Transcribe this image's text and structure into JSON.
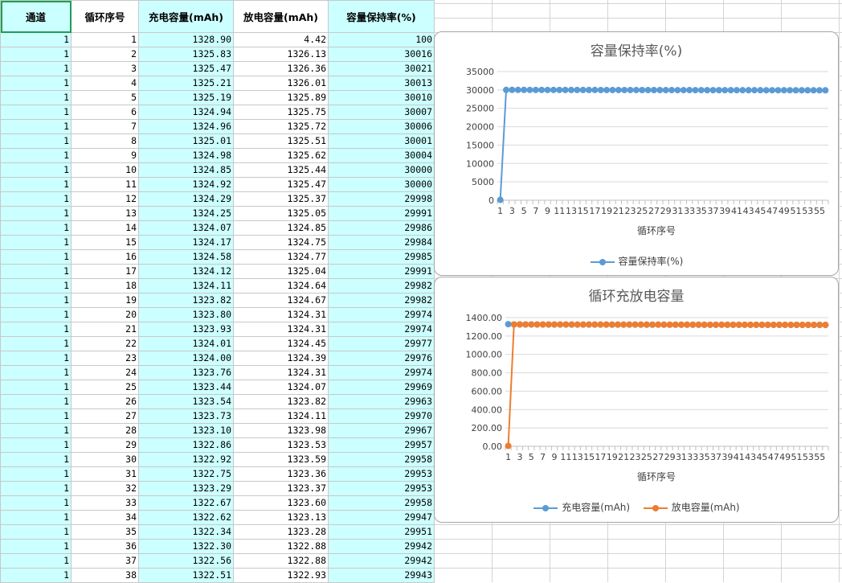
{
  "table": {
    "headers": [
      "通道",
      "循环序号",
      "充电容量(mAh)",
      "放电容量(mAh)",
      "容量保持率(%)"
    ],
    "rows": [
      [
        "1",
        "1",
        "1328.90",
        "4.42",
        "100"
      ],
      [
        "1",
        "2",
        "1325.83",
        "1326.13",
        "30016"
      ],
      [
        "1",
        "3",
        "1325.47",
        "1326.36",
        "30021"
      ],
      [
        "1",
        "4",
        "1325.21",
        "1326.01",
        "30013"
      ],
      [
        "1",
        "5",
        "1325.19",
        "1325.89",
        "30010"
      ],
      [
        "1",
        "6",
        "1324.94",
        "1325.75",
        "30007"
      ],
      [
        "1",
        "7",
        "1324.96",
        "1325.72",
        "30006"
      ],
      [
        "1",
        "8",
        "1325.01",
        "1325.51",
        "30001"
      ],
      [
        "1",
        "9",
        "1324.98",
        "1325.62",
        "30004"
      ],
      [
        "1",
        "10",
        "1324.85",
        "1325.44",
        "30000"
      ],
      [
        "1",
        "11",
        "1324.92",
        "1325.47",
        "30000"
      ],
      [
        "1",
        "12",
        "1324.29",
        "1325.37",
        "29998"
      ],
      [
        "1",
        "13",
        "1324.25",
        "1325.05",
        "29991"
      ],
      [
        "1",
        "14",
        "1324.07",
        "1324.85",
        "29986"
      ],
      [
        "1",
        "15",
        "1324.17",
        "1324.75",
        "29984"
      ],
      [
        "1",
        "16",
        "1324.58",
        "1324.77",
        "29985"
      ],
      [
        "1",
        "17",
        "1324.12",
        "1325.04",
        "29991"
      ],
      [
        "1",
        "18",
        "1324.11",
        "1324.64",
        "29982"
      ],
      [
        "1",
        "19",
        "1323.82",
        "1324.67",
        "29982"
      ],
      [
        "1",
        "20",
        "1323.80",
        "1324.31",
        "29974"
      ],
      [
        "1",
        "21",
        "1323.93",
        "1324.31",
        "29974"
      ],
      [
        "1",
        "22",
        "1324.01",
        "1324.45",
        "29977"
      ],
      [
        "1",
        "23",
        "1324.00",
        "1324.39",
        "29976"
      ],
      [
        "1",
        "24",
        "1323.76",
        "1324.31",
        "29974"
      ],
      [
        "1",
        "25",
        "1323.44",
        "1324.07",
        "29969"
      ],
      [
        "1",
        "26",
        "1323.54",
        "1323.82",
        "29963"
      ],
      [
        "1",
        "27",
        "1323.73",
        "1324.11",
        "29970"
      ],
      [
        "1",
        "28",
        "1323.10",
        "1323.98",
        "29967"
      ],
      [
        "1",
        "29",
        "1322.86",
        "1323.53",
        "29957"
      ],
      [
        "1",
        "30",
        "1322.92",
        "1323.59",
        "29958"
      ],
      [
        "1",
        "31",
        "1322.75",
        "1323.36",
        "29953"
      ],
      [
        "1",
        "32",
        "1323.29",
        "1323.37",
        "29953"
      ],
      [
        "1",
        "33",
        "1322.67",
        "1323.60",
        "29958"
      ],
      [
        "1",
        "34",
        "1322.62",
        "1323.13",
        "29947"
      ],
      [
        "1",
        "35",
        "1322.34",
        "1323.28",
        "29951"
      ],
      [
        "1",
        "36",
        "1322.30",
        "1322.88",
        "29942"
      ],
      [
        "1",
        "37",
        "1322.56",
        "1322.88",
        "29942"
      ],
      [
        "1",
        "38",
        "1322.51",
        "1322.93",
        "29943"
      ]
    ]
  },
  "colors": {
    "cyan_column": "#ccffff",
    "selection": "#1f9d55",
    "series_blue": "#5b9bd5",
    "series_orange": "#ed7d31"
  },
  "chart_data": [
    {
      "type": "line",
      "title": "容量保持率(%)",
      "xlabel": "循环序号",
      "ylabel": "",
      "ylim": [
        0,
        35000
      ],
      "yticks": [
        "0",
        "5000",
        "10000",
        "15000",
        "20000",
        "25000",
        "30000",
        "35000"
      ],
      "xticks": [
        "1",
        "3",
        "5",
        "7",
        "9",
        "11",
        "13",
        "15",
        "17",
        "19",
        "21",
        "23",
        "25",
        "27",
        "29",
        "31",
        "33",
        "35",
        "37",
        "39",
        "41",
        "43",
        "45",
        "47",
        "49",
        "51",
        "53",
        "55"
      ],
      "x_count": 56,
      "grid": true,
      "legend_position": "bottom",
      "series": [
        {
          "name": "容量保持率(%)",
          "color": "#5b9bd5",
          "values": [
            100,
            30016,
            30021,
            30013,
            30010,
            30007,
            30006,
            30001,
            30004,
            30000,
            30000,
            29998,
            29991,
            29986,
            29984,
            29985,
            29991,
            29982,
            29982,
            29974,
            29974,
            29977,
            29976,
            29974,
            29969,
            29963,
            29970,
            29967,
            29957,
            29958,
            29953,
            29953,
            29958,
            29947,
            29951,
            29942,
            29942,
            29943,
            29940,
            29938,
            29936,
            29934,
            29932,
            29930,
            29928,
            29926,
            29924,
            29922,
            29920,
            29918,
            29916,
            29914,
            29912,
            29910,
            29908,
            29906
          ]
        }
      ]
    },
    {
      "type": "line",
      "title": "循环充放电容量",
      "xlabel": "循环序号",
      "ylabel": "",
      "ylim": [
        0,
        1400
      ],
      "yticks": [
        "0.00",
        "200.00",
        "400.00",
        "600.00",
        "800.00",
        "1000.00",
        "1200.00",
        "1400.00"
      ],
      "xticks": [
        "1",
        "3",
        "5",
        "7",
        "9",
        "11",
        "13",
        "15",
        "17",
        "19",
        "21",
        "23",
        "25",
        "27",
        "29",
        "31",
        "33",
        "35",
        "37",
        "39",
        "41",
        "43",
        "45",
        "47",
        "49",
        "51",
        "53",
        "55"
      ],
      "x_count": 56,
      "grid": true,
      "legend_position": "bottom",
      "series": [
        {
          "name": "充电容量(mAh)",
          "color": "#5b9bd5",
          "values": [
            1328.9,
            1325.83,
            1325.47,
            1325.21,
            1325.19,
            1324.94,
            1324.96,
            1325.01,
            1324.98,
            1324.85,
            1324.92,
            1324.29,
            1324.25,
            1324.07,
            1324.17,
            1324.58,
            1324.12,
            1324.11,
            1323.82,
            1323.8,
            1323.93,
            1324.01,
            1324.0,
            1323.76,
            1323.44,
            1323.54,
            1323.73,
            1323.1,
            1322.86,
            1322.92,
            1322.75,
            1323.29,
            1322.67,
            1322.62,
            1322.34,
            1322.3,
            1322.56,
            1322.51,
            1322.4,
            1322.3,
            1322.2,
            1322.1,
            1322.0,
            1321.9,
            1321.8,
            1321.7,
            1321.6,
            1321.5,
            1321.4,
            1321.3,
            1321.2,
            1321.1,
            1321.0,
            1320.9,
            1320.8,
            1320.7
          ]
        },
        {
          "name": "放电容量(mAh)",
          "color": "#ed7d31",
          "values": [
            4.42,
            1326.13,
            1326.36,
            1326.01,
            1325.89,
            1325.75,
            1325.72,
            1325.51,
            1325.62,
            1325.44,
            1325.47,
            1325.37,
            1325.05,
            1324.85,
            1324.75,
            1324.77,
            1325.04,
            1324.64,
            1324.67,
            1324.31,
            1324.31,
            1324.45,
            1324.39,
            1324.31,
            1324.07,
            1323.82,
            1324.11,
            1323.98,
            1323.53,
            1323.59,
            1323.36,
            1323.37,
            1323.6,
            1323.13,
            1323.28,
            1322.88,
            1322.88,
            1322.93,
            1322.8,
            1322.7,
            1322.6,
            1322.5,
            1322.4,
            1322.3,
            1322.2,
            1322.1,
            1322.0,
            1321.9,
            1321.8,
            1321.7,
            1321.6,
            1321.5,
            1321.4,
            1321.3,
            1321.2,
            1321.1
          ]
        }
      ]
    }
  ]
}
